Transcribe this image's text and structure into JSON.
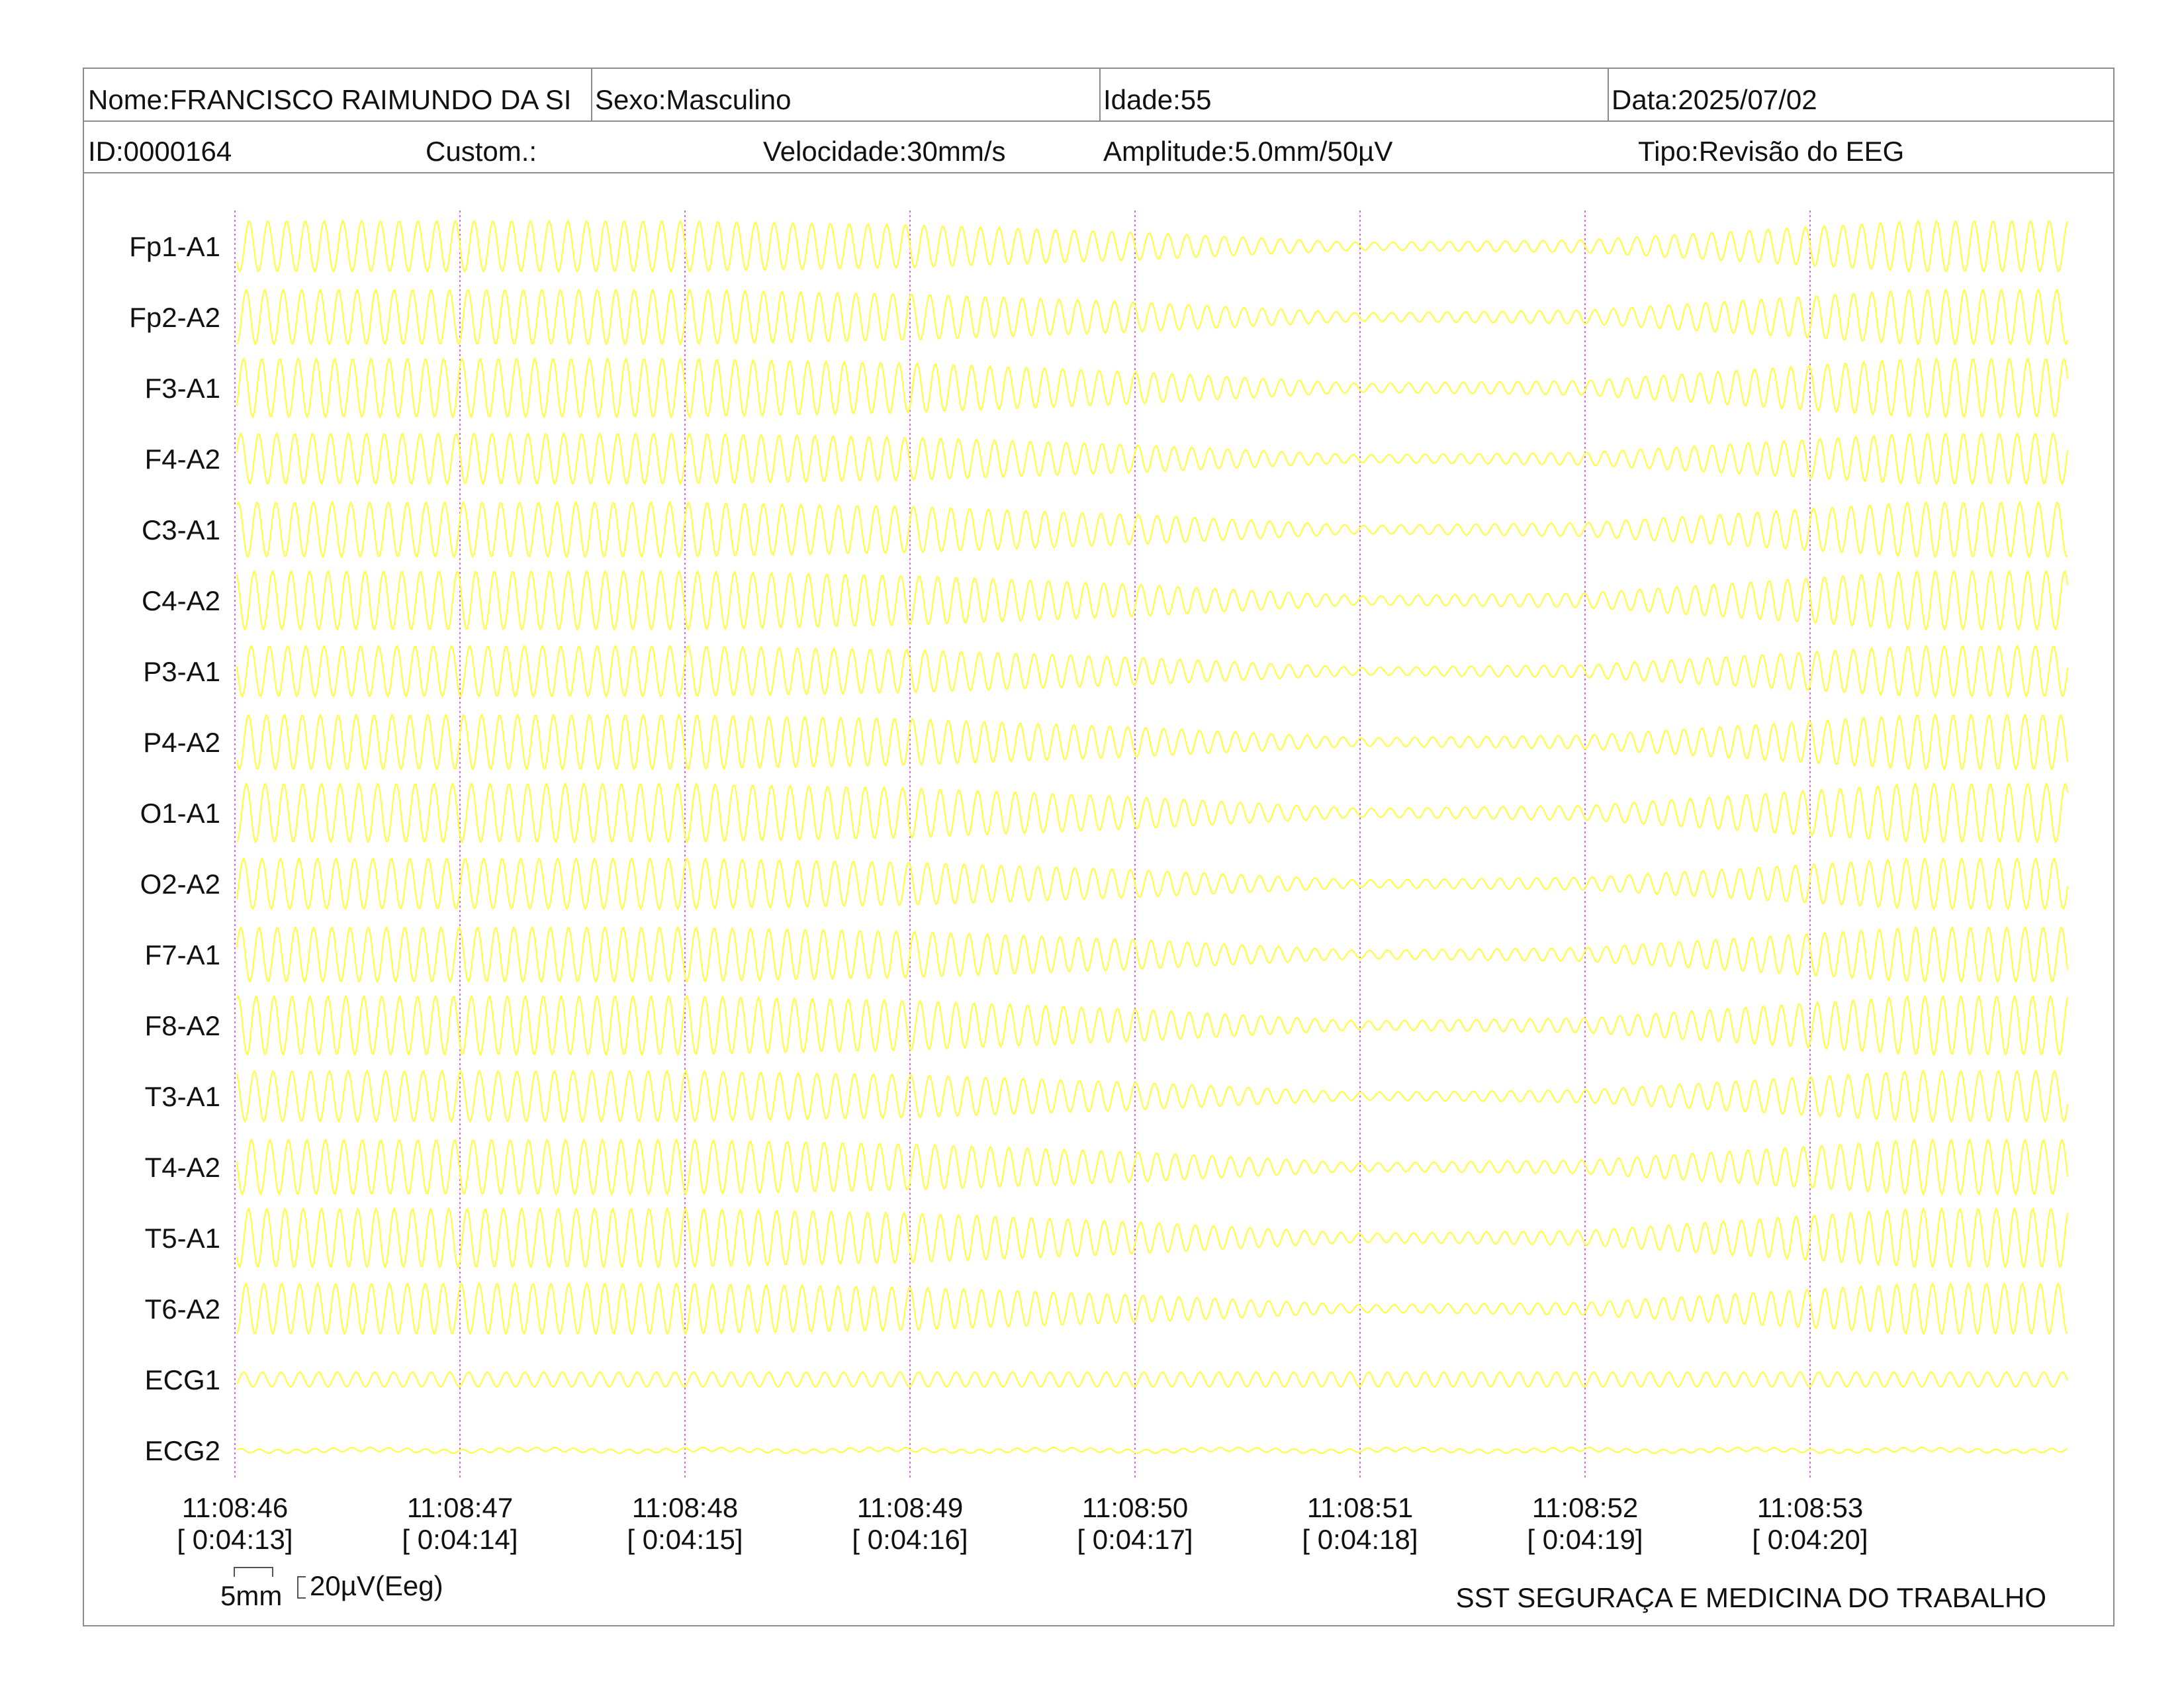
{
  "header": {
    "nome": "Nome:FRANCISCO RAIMUNDO DA SI",
    "sexo": "Sexo:Masculino",
    "idade": "Idade:55",
    "data": "Data:2025/07/02",
    "id": "ID:0000164",
    "custom": "Custom.:",
    "velocidade": "Velocidade:30mm/s",
    "amplitude": "Amplitude:5.0mm/50µV",
    "tipo": "Tipo:Revisão do EEG"
  },
  "scale": {
    "time_label": "5mm",
    "amp_label": "20µV(Eeg)"
  },
  "footer": {
    "company": "SST SEGURAÇA E MEDICINA DO TRABALHO"
  },
  "colors": {
    "trace": "#ffff33",
    "time_marker": "#e066e0",
    "border": "#8c8c8c"
  },
  "chart_data": {
    "type": "line",
    "grid": false,
    "channels": [
      "Fp1-A1",
      "Fp2-A2",
      "F3-A1",
      "F4-A2",
      "C3-A1",
      "C4-A2",
      "P3-A1",
      "P4-A2",
      "O1-A1",
      "O2-A2",
      "F7-A1",
      "F8-A2",
      "T3-A1",
      "T4-A2",
      "T5-A1",
      "T6-A2",
      "ECG1",
      "ECG2"
    ],
    "time_ticks": [
      {
        "clock": "11:08:46",
        "elapsed": "[ 0:04:13]"
      },
      {
        "clock": "11:08:47",
        "elapsed": "[ 0:04:14]"
      },
      {
        "clock": "11:08:48",
        "elapsed": "[ 0:04:15]"
      },
      {
        "clock": "11:08:49",
        "elapsed": "[ 0:04:16]"
      },
      {
        "clock": "11:08:50",
        "elapsed": "[ 0:04:17]"
      },
      {
        "clock": "11:08:51",
        "elapsed": "[ 0:04:18]"
      },
      {
        "clock": "11:08:52",
        "elapsed": "[ 0:04:19]"
      },
      {
        "clock": "11:08:53",
        "elapsed": "[ 0:04:20]"
      }
    ],
    "time_range_s": [
      -0.65,
      7.45
    ],
    "oscillation_hz": 12,
    "amplitude_envelope": {
      "time_s": [
        -0.65,
        2.0,
        3.0,
        4.0,
        5.0,
        6.0,
        7.45
      ],
      "relative": [
        1.0,
        1.0,
        0.85,
        0.55,
        0.15,
        0.25,
        1.0
      ]
    }
  }
}
